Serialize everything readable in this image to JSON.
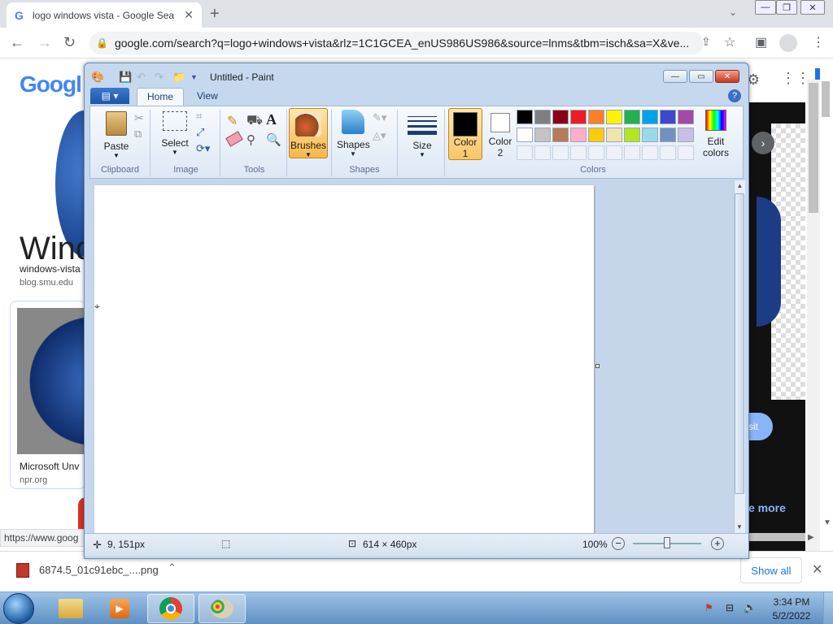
{
  "browser": {
    "tab_title": "logo windows vista - Google Sea",
    "url": "google.com/search?q=logo+windows+vista&rlz=1C1GCEA_enUS986US986&source=lnms&tbm=isch&sa=X&ve...",
    "tab_favicon": "G"
  },
  "google": {
    "logo_text": "Googl",
    "result1_title": "Wind",
    "result1_caption": "windows-vista",
    "result1_source": "blog.smu.edu",
    "result2_caption": "Microsoft Unv",
    "result2_source": "npr.org",
    "visit_label": "sit",
    "see_more": "e more",
    "status_url": "https://www.goog"
  },
  "download": {
    "file_name": "6874.5_01c91ebc_....png",
    "show_all": "Show all"
  },
  "taskbar": {
    "time": "3:34 PM",
    "date": "5/2/2022"
  },
  "paint": {
    "title": "Untitled - Paint",
    "tabs": {
      "home": "Home",
      "view": "View"
    },
    "groups": {
      "clipboard": "Clipboard",
      "image": "Image",
      "tools": "Tools",
      "shapes": "Shapes",
      "colors": "Colors"
    },
    "buttons": {
      "paste": "Paste",
      "select": "Select",
      "brushes": "Brushes",
      "shapes": "Shapes",
      "size": "Size",
      "color1": "Color 1",
      "color1_a": "Color",
      "color1_b": "1",
      "color2_a": "Color",
      "color2_b": "2",
      "edit_colors_a": "Edit",
      "edit_colors_b": "colors"
    },
    "palette_row1": [
      "#000000",
      "#7f7f7f",
      "#880015",
      "#ed1c24",
      "#ff7f27",
      "#fff200",
      "#22b14c",
      "#00a2e8",
      "#3f48cc",
      "#a349a4"
    ],
    "palette_row2": [
      "#ffffff",
      "#c3c3c3",
      "#b97a57",
      "#ffaec9",
      "#ffc90e",
      "#efe4b0",
      "#b5e61d",
      "#99d9ea",
      "#7092be",
      "#c8bfe7"
    ],
    "color1_value": "#000000",
    "color2_value": "#ffffff",
    "status": {
      "cursor_pos": "9, 151px",
      "canvas_size": "614 × 460px",
      "zoom": "100%"
    }
  }
}
